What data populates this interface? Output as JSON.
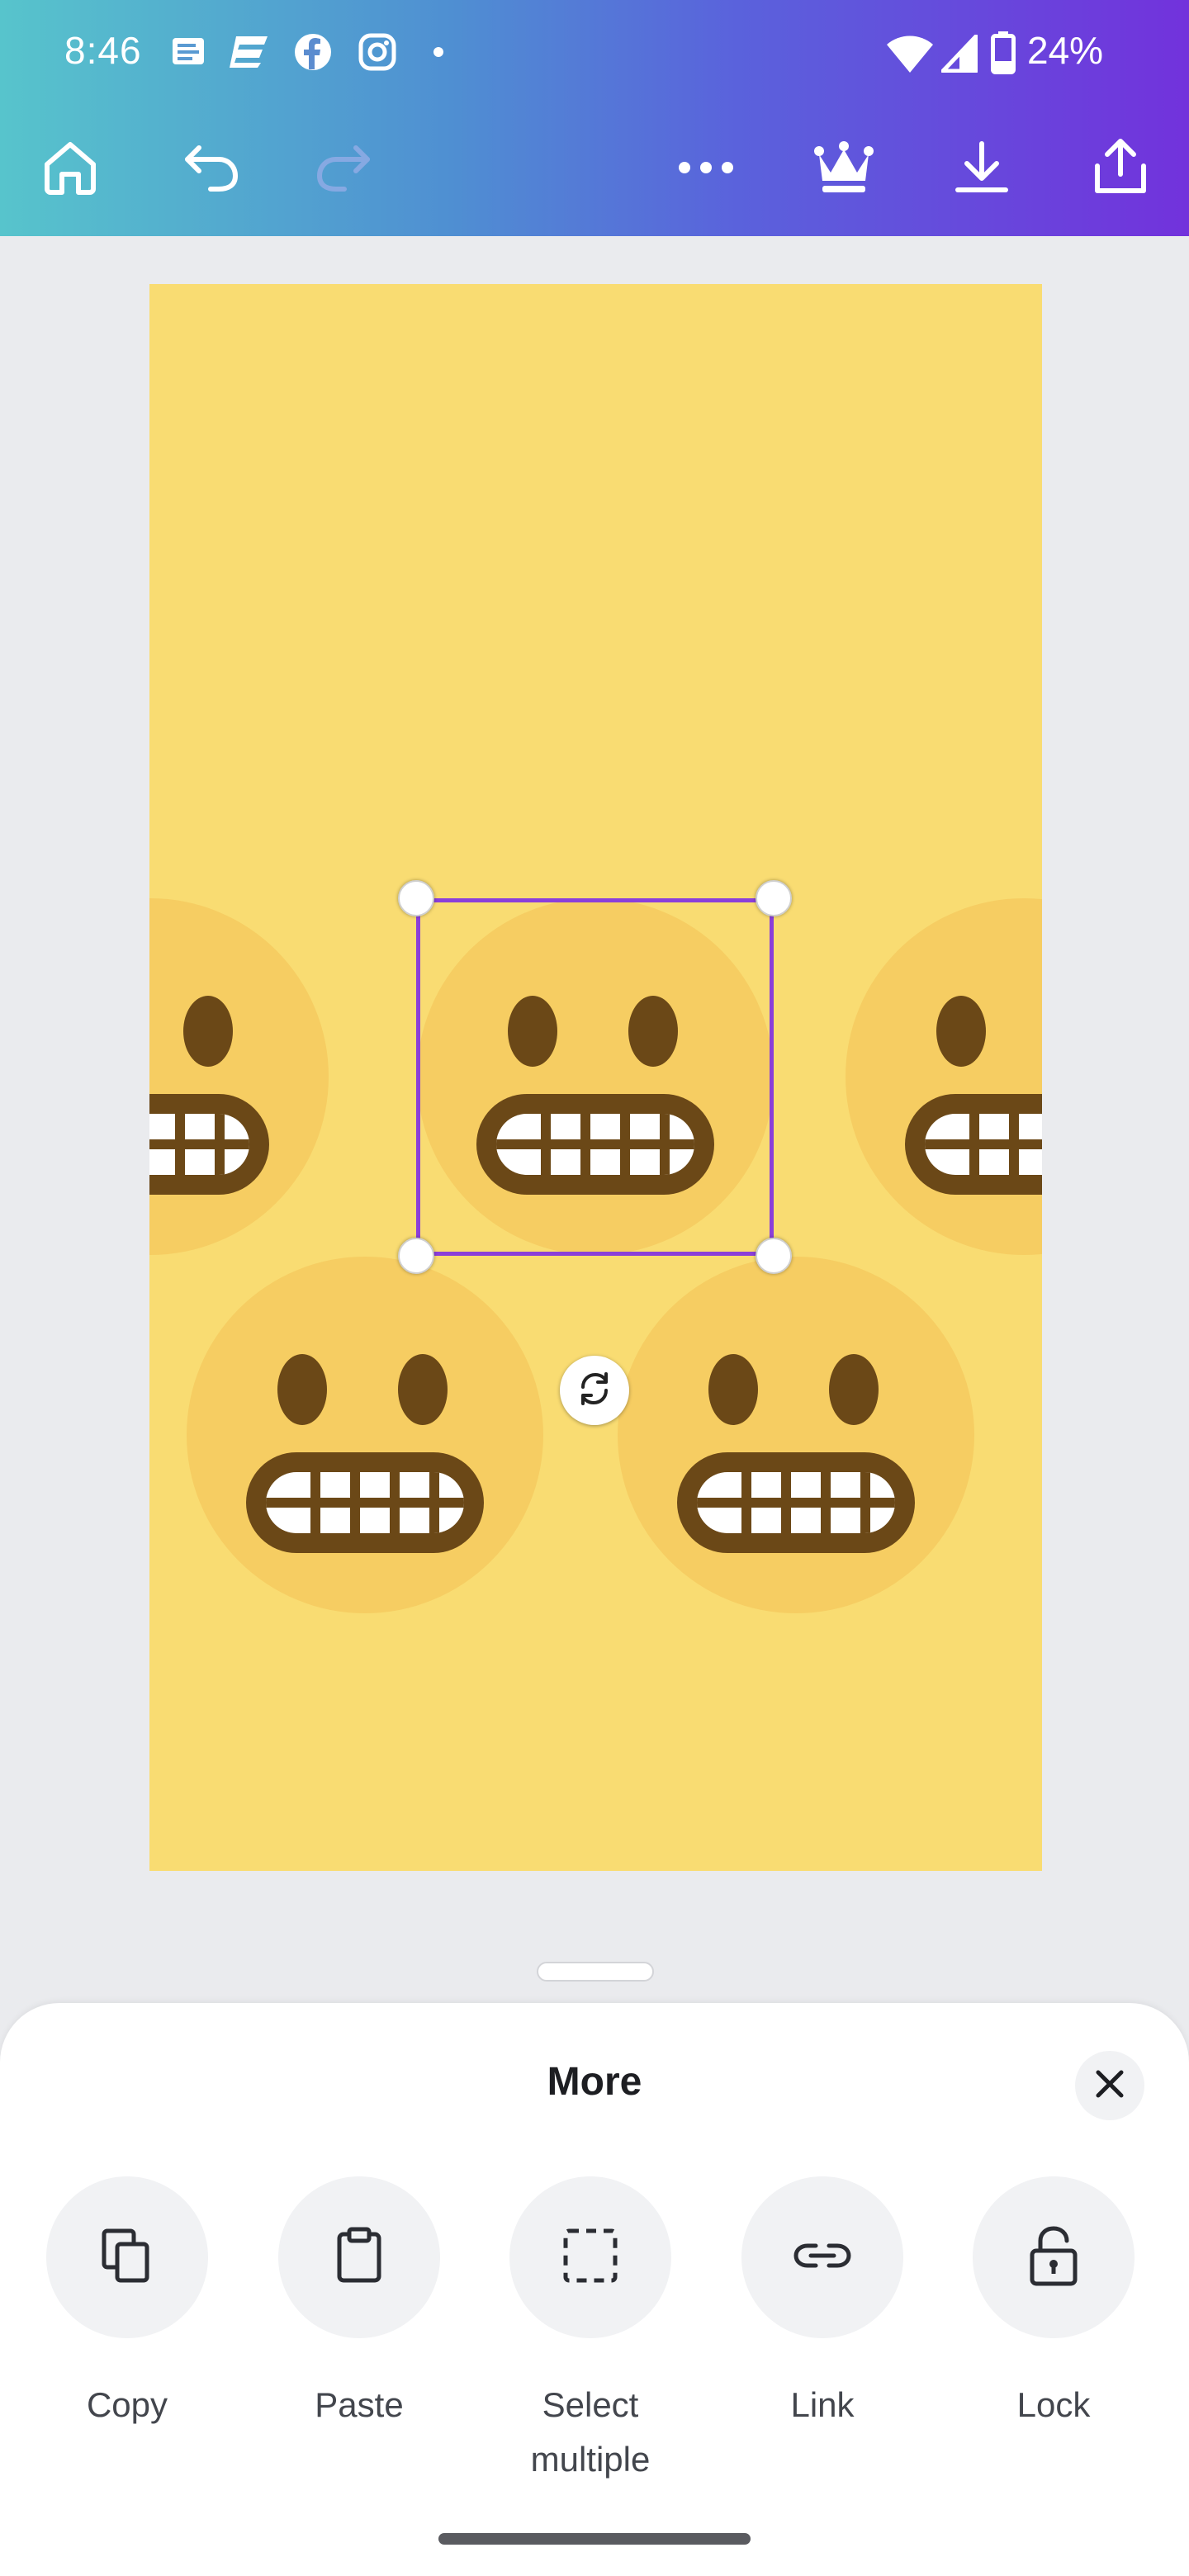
{
  "status_bar": {
    "time": "8:46",
    "battery": "24%",
    "icons": [
      "news-icon",
      "app-icon",
      "facebook-icon",
      "instagram-icon",
      "dot-icon",
      "wifi-icon",
      "signal-icon",
      "battery-icon"
    ]
  },
  "toolbar": {
    "buttons": [
      "home-icon",
      "undo-icon",
      "redo-icon",
      "more-icon",
      "crown-icon",
      "download-icon",
      "share-icon"
    ]
  },
  "canvas": {
    "background": "#f9dc72",
    "elements": [
      "grimacing-emoji",
      "grimacing-emoji",
      "grimacing-emoji",
      "grimacing-emoji",
      "grimacing-emoji"
    ],
    "selection_color": "#8b3fd9"
  },
  "sheet": {
    "title": "More",
    "actions": [
      {
        "label": "Copy",
        "icon": "copy-icon"
      },
      {
        "label": "Paste",
        "icon": "clipboard-icon"
      },
      {
        "label": "Select multiple",
        "label_line1": "Select",
        "label_line2": "multiple",
        "icon": "select-multiple-icon"
      },
      {
        "label": "Link",
        "icon": "link-icon"
      },
      {
        "label": "Lock",
        "icon": "lock-icon"
      }
    ]
  },
  "colors": {
    "gradient_start": "#57c4cc",
    "gradient_end": "#7232dc",
    "emoji_face": "#f6cd62",
    "emoji_features": "#6b4817"
  }
}
